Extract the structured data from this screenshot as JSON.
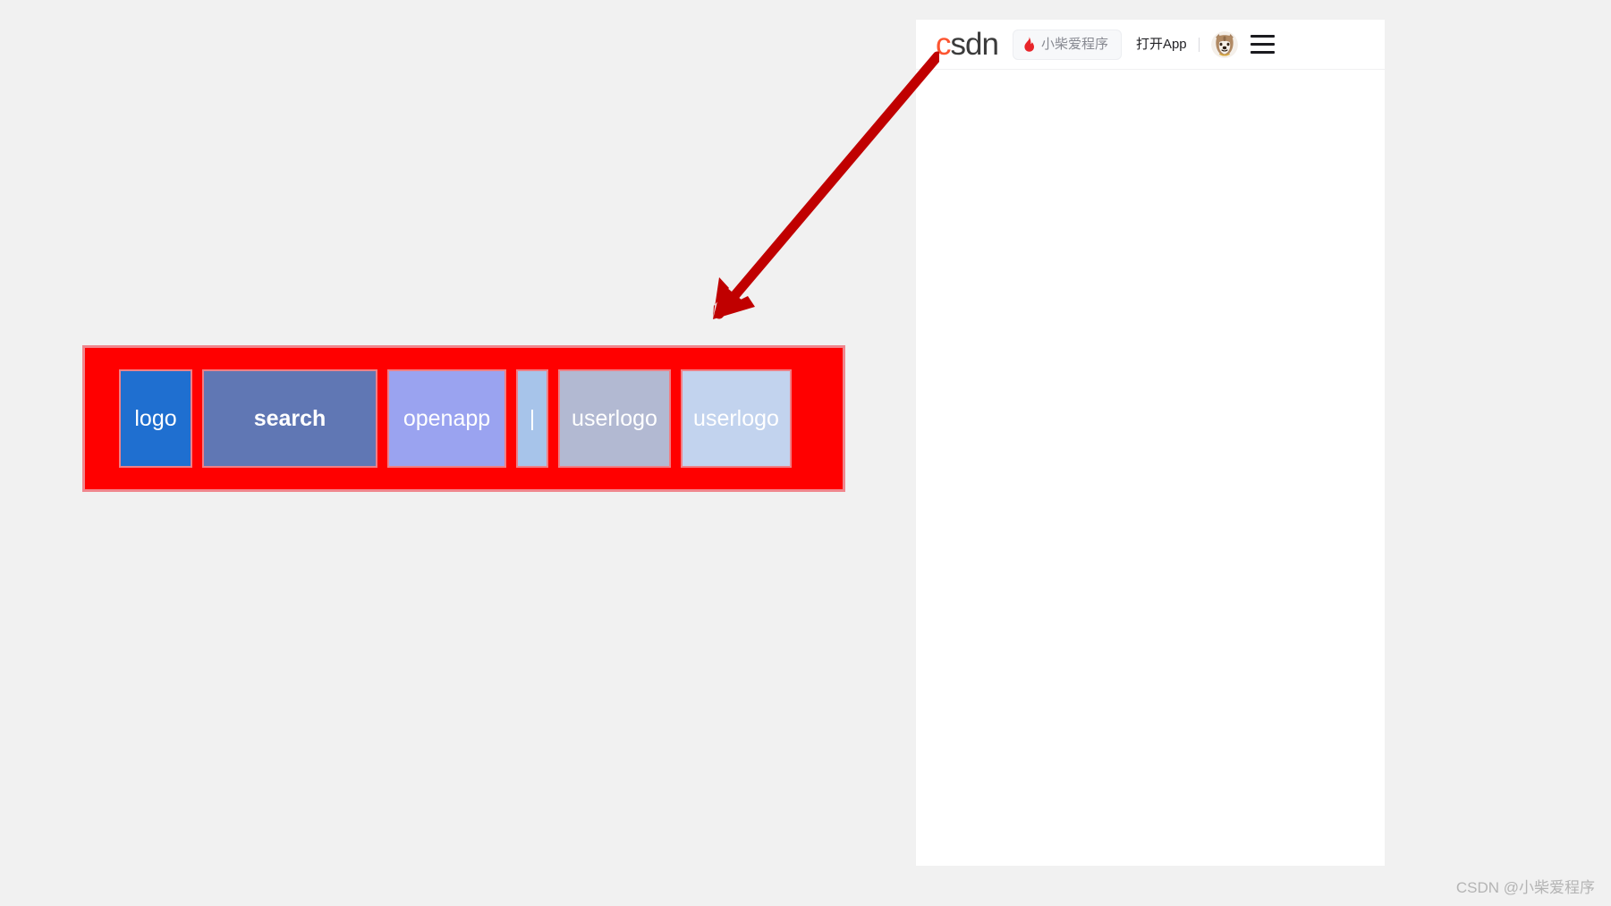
{
  "colors": {
    "page_background": "#f1f1f1",
    "panel_background": "#ffffff",
    "annotation_fill": "#ff0000",
    "annotation_border": "#f0868d",
    "arrow": "#c00000",
    "csdn_logo_accent": "#fc5531",
    "csdn_logo_text": "#3b3b3b",
    "flame_icon": "#e8252a",
    "watermark_text": "#b4b4b4"
  },
  "site_header": {
    "logo": {
      "name": "csdn-logo",
      "accent_letter": "c",
      "rest_letters": "sdn"
    },
    "search_pill": {
      "icon": "flame-icon",
      "text": "小柴爱程序"
    },
    "open_app_label": "打开App",
    "divider": "|",
    "avatar": {
      "icon": "shiba-avatar-icon",
      "alt": "userlogo"
    },
    "menu": {
      "icon": "hamburger-menu-icon",
      "lines": 3
    }
  },
  "annotation": {
    "boxes": [
      {
        "label": "logo",
        "color": "#1f6fd0"
      },
      {
        "label": "search",
        "color": "#6077b4"
      },
      {
        "label": "openapp",
        "color": "#9aa3f0"
      },
      {
        "label": "|",
        "color": "#a7c4ea"
      },
      {
        "label": "userlogo",
        "color": "#b2b9d2"
      },
      {
        "label": "userlogo",
        "color": "#c2d3ee"
      }
    ],
    "arrow": {
      "name": "red-pointer-arrow",
      "direction": "down-left",
      "from": "site-header",
      "to": "annotation-diagram"
    }
  },
  "watermark": {
    "text": "CSDN @小柴爱程序"
  }
}
